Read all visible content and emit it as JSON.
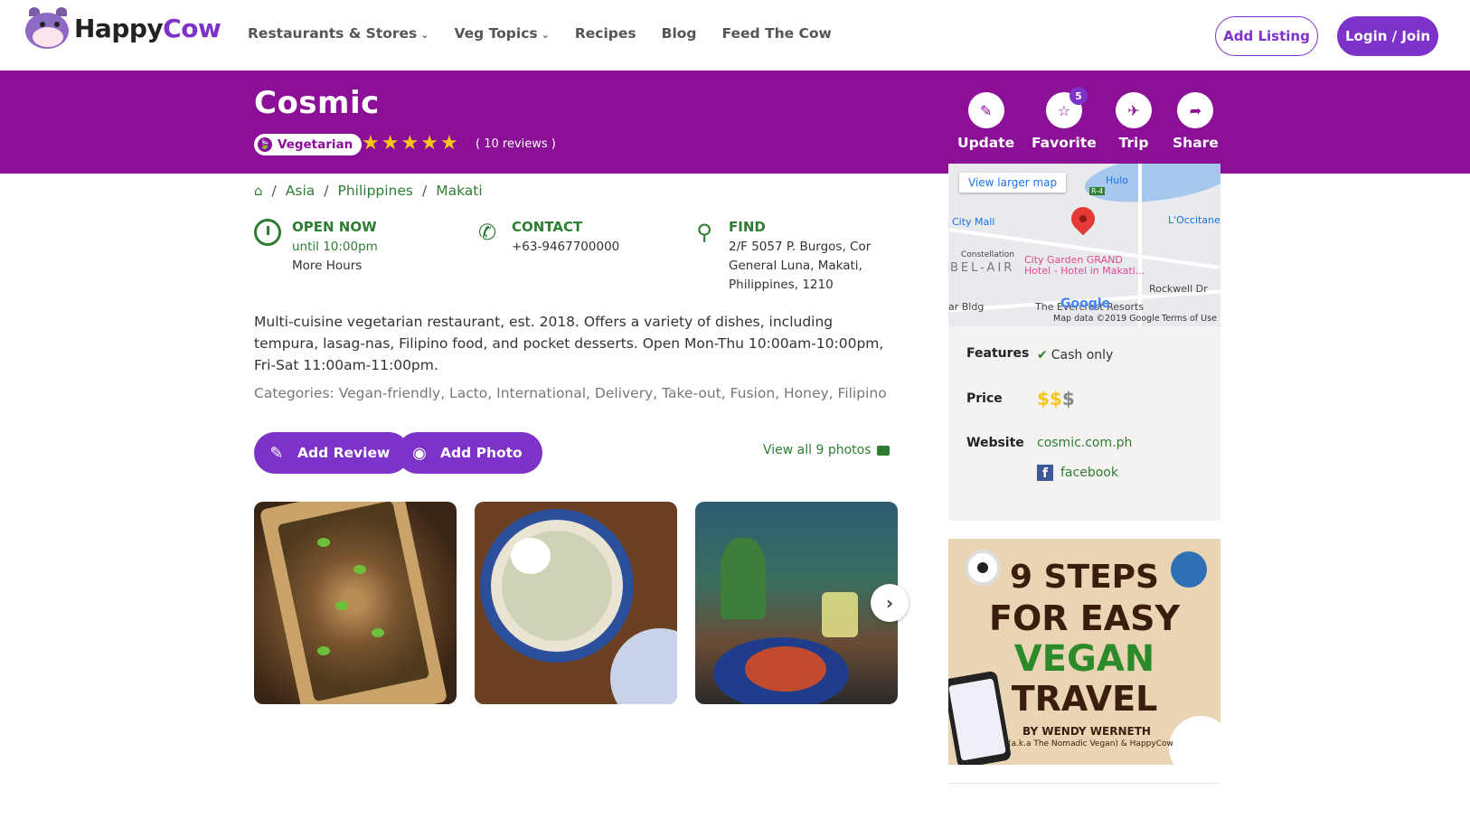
{
  "nav": {
    "logo_part1": "Happy",
    "logo_part2": "Cow",
    "links": [
      "Restaurants & Stores",
      "Veg Topics",
      "Recipes",
      "Blog",
      "Feed The Cow"
    ],
    "add_listing": "Add Listing",
    "login": "Login / Join"
  },
  "listing": {
    "name": "Cosmic",
    "type": "Vegetarian",
    "reviews": "( 10 reviews )",
    "rating_stars": 5
  },
  "actions": {
    "update": "Update",
    "favorite": "Favorite",
    "favorite_count": "5",
    "trip": "Trip",
    "share": "Share"
  },
  "breadcrumb": [
    "Asia",
    "Philippines",
    "Makati"
  ],
  "info": {
    "open_title": "OPEN NOW",
    "open_until": "until 10:00pm",
    "more_hours": "More Hours",
    "contact_title": "CONTACT",
    "phone": "+63-9467700000",
    "find_title": "FIND",
    "address_line1": "2/F 5057 P. Burgos, Cor",
    "address_line2": "General Luna, Makati,",
    "address_line3": "Philippines, 1210"
  },
  "description": "Multi-cuisine vegetarian restaurant, est. 2018. Offers a variety of dishes, including tempura, lasag-nas, Filipino food, and pocket desserts. Open Mon-Thu 10:00am-10:00pm, Fri-Sat 11:00am-11:00pm.",
  "categories": "Categories: Vegan-friendly, Lacto, International, Delivery, Take-out, Fusion, Honey, Filipino",
  "buttons": {
    "add_review": "Add Review",
    "add_photo": "Add Photo",
    "view_all": "View all 9 photos"
  },
  "map": {
    "view_larger": "View larger map",
    "labels": [
      "Hulo",
      "L'Occitane",
      "City Mall",
      "City Garden GRAND",
      "Hotel - Hotel in Makati...",
      "BEL-AIR",
      "Rockwell Dr",
      "ar Bldg",
      "The Evercrest Resorts",
      "Constellation",
      "R-4"
    ],
    "brand": "Google",
    "data": "Map data ©2019 Google",
    "terms": "Terms of Use"
  },
  "features": {
    "features_label": "Features",
    "features_value": "Cash only",
    "price_label": "Price",
    "price_level": 2,
    "price_max": 3,
    "website_label": "Website",
    "website": "cosmic.com.ph",
    "facebook": "facebook"
  },
  "ad": {
    "line1": "9 STEPS",
    "line2": "FOR EASY",
    "line3": "VEGAN",
    "line4": "TRAVEL",
    "by": "BY WENDY WERNETH",
    "aka": "(a.k.a The Nomadic Vegan) & HappyCow"
  }
}
